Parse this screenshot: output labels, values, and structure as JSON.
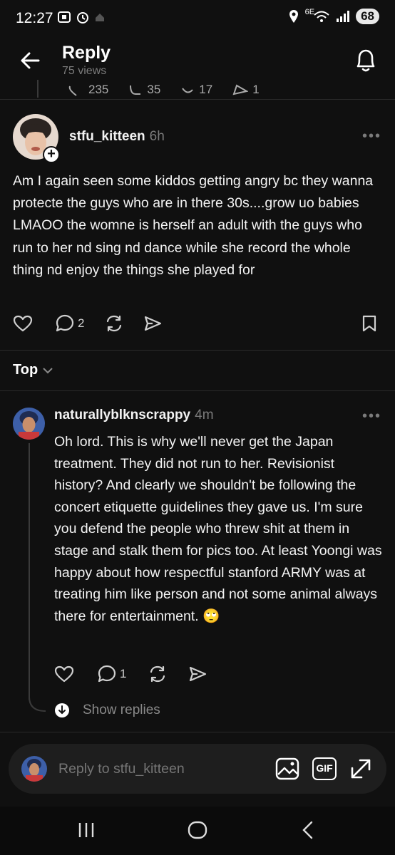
{
  "status_bar": {
    "time": "12:27",
    "network": "6E",
    "battery": "68"
  },
  "header": {
    "title": "Reply",
    "views": "75 views"
  },
  "previous_post": {
    "likes": "235",
    "replies": "35",
    "reposts": "17",
    "shares": "1"
  },
  "post": {
    "username": "stfu_kitteen",
    "time": "6h",
    "text": "Am I again seen some kiddos getting angry bc they wanna protecte the guys who are in there 30s....grow uo babies LMAOO the womne is herself an adult with the guys who run to her nd sing nd dance while she record the whole thing nd enjoy the things she played for",
    "reply_count": "2"
  },
  "sort": {
    "label": "Top"
  },
  "reply": {
    "username": "naturallyblknscrappy",
    "time": "4m",
    "text": "Oh lord. This is why we'll never get the Japan treatment. They did not run to her. Revisionist history? And clearly we shouldn't be following the concert etiquette guidelines they gave us. I'm sure you defend the people who threw shit at them in stage and stalk them for pics too. At least Yoongi was happy about how respectful stanford ARMY was at treating him like person and not some animal always there for entertainment. 🙄",
    "reply_count": "1",
    "show_replies": "Show replies"
  },
  "composer": {
    "placeholder": "Reply to stfu_kitteen",
    "gif_label": "GIF"
  },
  "icons": [
    "back-arrow-icon",
    "bell-icon",
    "heart-icon",
    "comment-icon",
    "repost-icon",
    "share-icon",
    "bookmark-icon",
    "image-icon",
    "expand-icon"
  ]
}
